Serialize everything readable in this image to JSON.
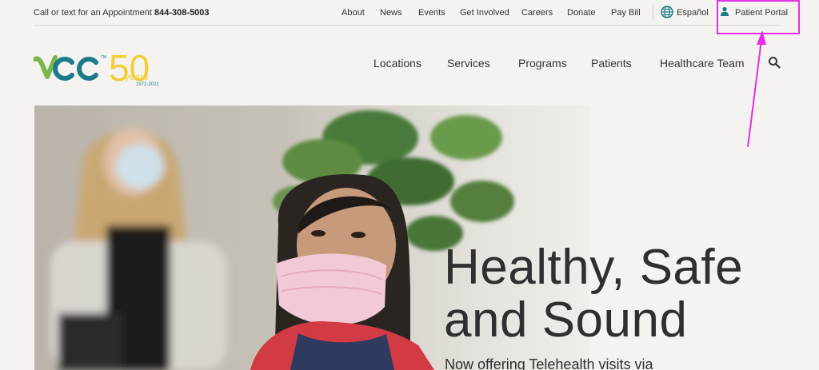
{
  "topbar": {
    "call_text": "Call or text for an Appointment",
    "phone": "844-308-5003",
    "links": [
      "About",
      "News",
      "Events",
      "Get Involved",
      "Careers",
      "Donate",
      "Pay Bill"
    ],
    "espanol": "Español",
    "portal": "Patient Portal"
  },
  "logo": {
    "brand": "vcc",
    "anniversary_number": "50",
    "anniversary_word": "years",
    "anniversary_range": "1972-2022"
  },
  "nav": {
    "items": [
      "Locations",
      "Services",
      "Programs",
      "Patients",
      "Healthcare Team"
    ]
  },
  "hero": {
    "headline_line1": "Healthy, Safe",
    "headline_line2": "and Sound",
    "subline": "Now offering Telehealth visits via"
  },
  "colors": {
    "accent_green": "#7ab648",
    "accent_teal": "#1b7a8c",
    "anniversary_yellow": "#f2cf3a",
    "annotation": "#e62ee6"
  },
  "icons": {
    "globe": "globe-icon",
    "person": "person-icon",
    "search": "search-icon"
  }
}
